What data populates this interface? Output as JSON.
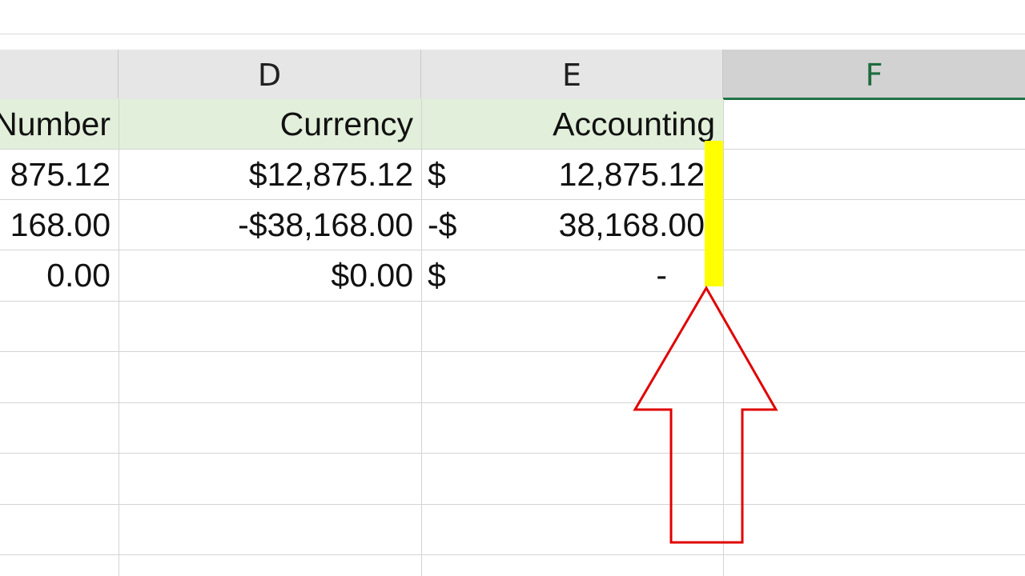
{
  "columns": {
    "partial": "",
    "d": "D",
    "e": "E",
    "f": "F"
  },
  "header_row": {
    "number": "Number",
    "currency": "Currency",
    "accounting": "Accounting"
  },
  "rows": [
    {
      "number": "875.12",
      "currency": "$12,875.12",
      "acct_symbol": "$",
      "acct_value": "12,875.12"
    },
    {
      "number": "168.00",
      "currency": "-$38,168.00",
      "acct_symbol": "-$",
      "acct_value": "38,168.00"
    },
    {
      "number": "0.00",
      "currency": "$0.00",
      "acct_symbol": "$",
      "acct_value": "-"
    }
  ],
  "colors": {
    "header_fill": "#e2efda",
    "highlight": "#ffff00",
    "arrow": "#e00000",
    "selected_column_accent": "#217346"
  },
  "annotations": {
    "arrow_icon": "up-arrow-outline",
    "highlight_marker": "yellow-marker"
  }
}
